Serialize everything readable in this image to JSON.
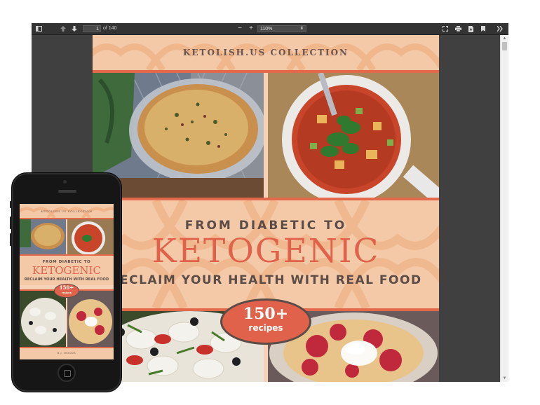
{
  "viewer": {
    "toolbar": {
      "page_current": "1",
      "page_total_label": "of 140",
      "zoom_minus": "−",
      "zoom_plus": "+",
      "zoom_value": "110%"
    }
  },
  "cover": {
    "collection": "KETOLISH.US COLLECTION",
    "title_line1": "FROM DIABETIC TO",
    "title_main": "KETOGENIC",
    "subtitle": "RECLAIM YOUR HEALTH WITH REAL FOOD",
    "badge_number": "150+",
    "badge_label": "recipes"
  },
  "phone_cover": {
    "collection": "KETOLISH.US COLLECTION",
    "title_line1": "FROM DIABETIC TO",
    "title_main": "KETOGENIC",
    "subtitle": "RECLAIM YOUR HEALTH WITH REAL FOOD",
    "badge_number": "150+",
    "badge_label": "recipes",
    "author": "B.J. WOODS"
  },
  "colors": {
    "accent": "#e0624a",
    "peach": "#f6d2b8",
    "text_dark": "#5b4c47",
    "viewer_bg": "#404040"
  },
  "icons": [
    "sidebar-toggle-icon",
    "arrow-up-icon",
    "arrow-down-icon",
    "fullscreen-icon",
    "print-icon",
    "download-icon",
    "bookmark-icon",
    "more-tools-icon"
  ]
}
